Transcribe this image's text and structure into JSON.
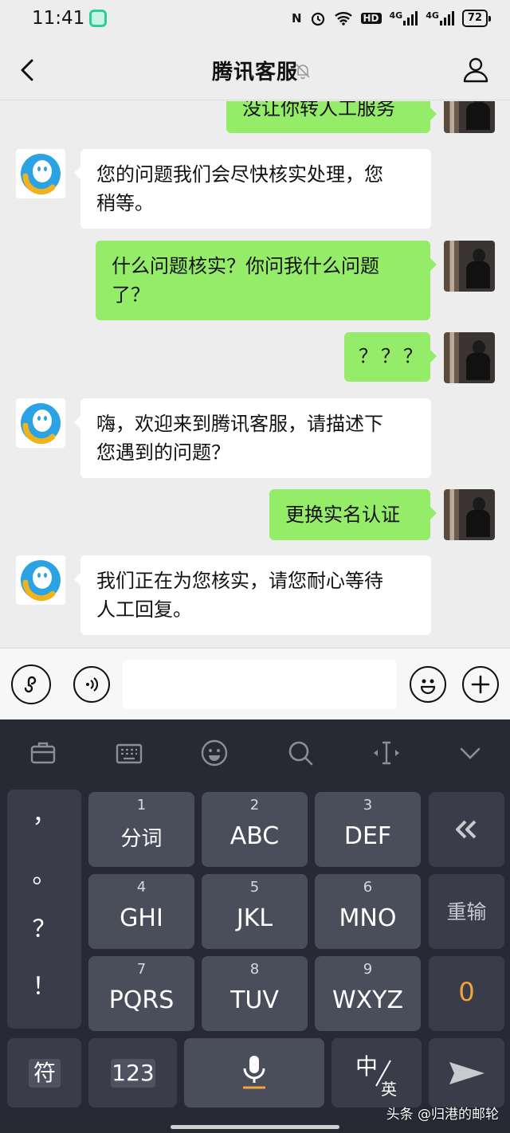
{
  "status_bar": {
    "time": "11:41",
    "indicators": [
      "nfc-icon",
      "alarm-icon",
      "wifi-icon",
      "hd-icon",
      "signal-4g-icon",
      "signal-4g-icon"
    ],
    "hd_label": "HD",
    "net1": "4G",
    "net2": "4G",
    "battery": "72"
  },
  "header": {
    "title": "腾讯客服"
  },
  "messages": [
    {
      "from": "user",
      "text": "没让你转人工服务"
    },
    {
      "from": "bot",
      "line1": "您的问题我们会尽快核实处理，您",
      "line2": "稍等。"
    },
    {
      "from": "user",
      "line1": "什么问题核实？你问我什么问题",
      "line2": "了？"
    },
    {
      "from": "user",
      "text": "？？？"
    },
    {
      "from": "bot",
      "line1": "嗨，欢迎来到腾讯客服，请描述下",
      "line2": "您遇到的问题？"
    },
    {
      "from": "user",
      "text": "更换实名认证"
    },
    {
      "from": "bot",
      "line1": "我们正在为您核实，请您耐心等待",
      "line2": "人工回复。"
    }
  ],
  "keyboard": {
    "punctuation": [
      "，",
      "。",
      "？",
      "！"
    ],
    "keys": [
      {
        "num": "1",
        "label": "分词"
      },
      {
        "num": "2",
        "label": "ABC"
      },
      {
        "num": "3",
        "label": "DEF"
      },
      {
        "num": "4",
        "label": "GHI"
      },
      {
        "num": "5",
        "label": "JKL"
      },
      {
        "num": "6",
        "label": "MNO"
      },
      {
        "num": "7",
        "label": "PQRS"
      },
      {
        "num": "8",
        "label": "TUV"
      },
      {
        "num": "9",
        "label": "WXYZ"
      }
    ],
    "reinput": "重输",
    "zero": "0",
    "symbol": "符",
    "numeric": "123",
    "lang_top": "中",
    "lang_bottom": "英"
  },
  "watermark": "头条 @归港的邮轮",
  "colors": {
    "user_bubble": "#95ec69",
    "bot_bubble": "#ffffff",
    "keyboard_bg": "#272a35",
    "accent_orange": "#f0a43a"
  }
}
